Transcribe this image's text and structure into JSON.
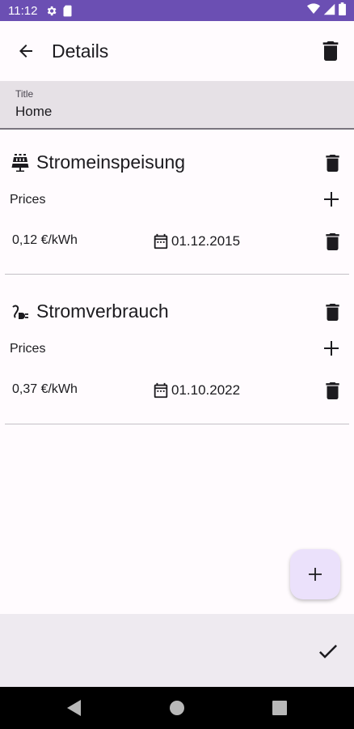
{
  "status_bar": {
    "time": "11:12"
  },
  "app_bar": {
    "title": "Details"
  },
  "title_field": {
    "label": "Title",
    "value": "Home"
  },
  "sections": [
    {
      "name": "Stromeinspeisung",
      "icon": "solar-panel-icon",
      "prices_label": "Prices",
      "prices": [
        {
          "amount": "0,12 €/kWh",
          "date": "01.12.2015"
        }
      ]
    },
    {
      "name": "Stromverbrauch",
      "icon": "plug-icon",
      "prices_label": "Prices",
      "prices": [
        {
          "amount": "0,37 €/kWh",
          "date": "01.10.2022"
        }
      ]
    }
  ],
  "colors": {
    "status_bar": "#6b4fb3",
    "fab": "#ebe1fb",
    "bottom_bar": "#eeeaf0",
    "title_field": "#e6e1e6"
  }
}
